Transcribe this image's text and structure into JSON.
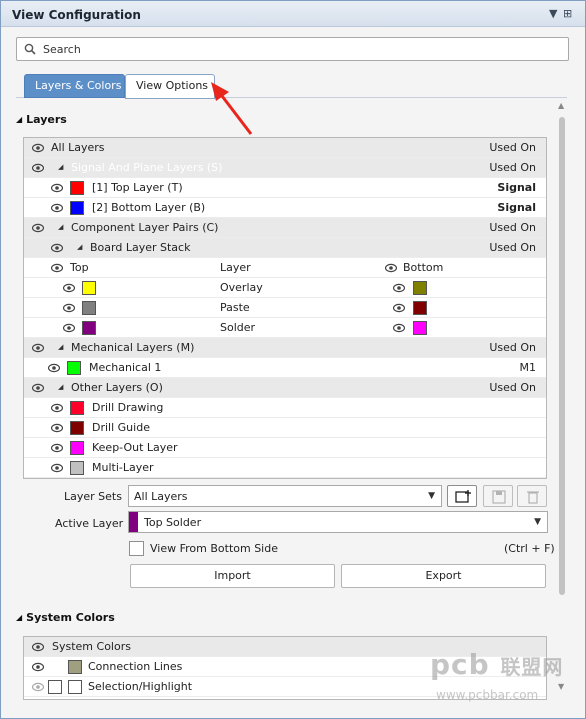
{
  "window": {
    "title": "View Configuration"
  },
  "search": {
    "placeholder": "Search"
  },
  "tabs": [
    {
      "label": "Layers & Colors",
      "active": true
    },
    {
      "label": "View Options",
      "active": false
    }
  ],
  "layers_section": {
    "heading": "Layers",
    "rows": {
      "all": {
        "name": "All Layers",
        "value": "Used On"
      },
      "signal_plane": {
        "name": "Signal And Plane Layers (S)",
        "value": "Used On"
      },
      "top_layer": {
        "name": "[1] Top Layer (T)",
        "value": "Signal",
        "color": "#ff0000"
      },
      "bottom_layer": {
        "name": "[2] Bottom Layer (B)",
        "value": "Signal",
        "color": "#0000ff"
      },
      "component_pairs": {
        "name": "Component Layer Pairs (C)",
        "value": "Used On"
      },
      "board_stack": {
        "name": "Board Layer Stack",
        "value": "Used On"
      },
      "pair_header": {
        "top": "Top",
        "layer": "Layer",
        "bottom": "Bottom"
      },
      "pairs": [
        {
          "layer": "Overlay",
          "top_color": "#ffff00",
          "bottom_color": "#808000"
        },
        {
          "layer": "Paste",
          "top_color": "#808080",
          "bottom_color": "#800000"
        },
        {
          "layer": "Solder",
          "top_color": "#800080",
          "bottom_color": "#ff00ff"
        }
      ],
      "mechanical": {
        "name": "Mechanical Layers (M)",
        "value": "Used On"
      },
      "mechanical1": {
        "name": "Mechanical 1",
        "value": "M1",
        "color": "#00ff00"
      },
      "other": {
        "name": "Other Layers (O)",
        "value": "Used On"
      },
      "others": [
        {
          "name": "Drill Drawing",
          "color": "#ff002a"
        },
        {
          "name": "Drill Guide",
          "color": "#800000"
        },
        {
          "name": "Keep-Out Layer",
          "color": "#ff00ff"
        },
        {
          "name": "Multi-Layer",
          "color": "#c0c0c0"
        }
      ]
    }
  },
  "layer_sets": {
    "label": "Layer Sets",
    "value": "All Layers"
  },
  "active_layer": {
    "label": "Active Layer",
    "value": "Top Solder",
    "color": "#800080"
  },
  "view_from_bottom": {
    "label": "View From Bottom Side",
    "shortcut": "(Ctrl + F)",
    "checked": false
  },
  "buttons": {
    "import": "Import",
    "export": "Export"
  },
  "system_colors": {
    "heading": "System Colors",
    "header_row": "System Colors",
    "rows": [
      {
        "name": "Connection Lines",
        "color": "#a0a080"
      },
      {
        "name": "Selection/Highlight",
        "color": "#ffffff"
      }
    ]
  },
  "watermark": {
    "brand": "pcb",
    "cn": "联盟网",
    "url": "www.pcbbar.com"
  },
  "colors": {
    "tab_active": "#5c8fc8",
    "annotation_arrow": "#e8261c",
    "row_shade": "#e9e9e9"
  }
}
